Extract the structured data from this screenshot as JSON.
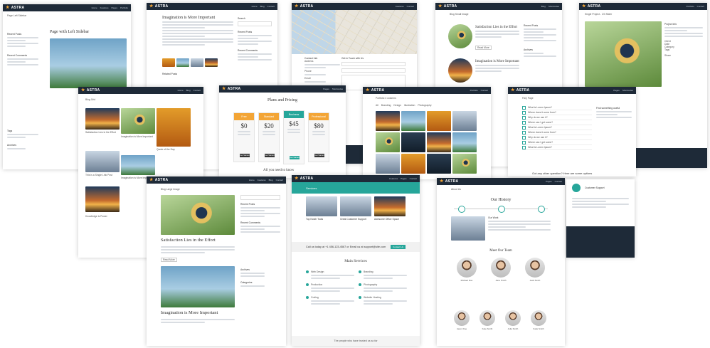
{
  "brand": {
    "name": "ASTRA",
    "accent": "#26a69a",
    "nav_bg": "#1e2a38",
    "logo_color": "#f3a536"
  },
  "menu": [
    "Home",
    "Features",
    "Pages",
    "Portfolio",
    "Blog",
    "Shortcodes",
    "Contact"
  ],
  "pages": {
    "left_sidebar": {
      "breadcrumb": "Page Left Sidebar",
      "title": "Page with Left Sidebar",
      "widgets": [
        "Recent Posts",
        "Recent Comments",
        "Archives",
        "Tags"
      ]
    },
    "imagination": {
      "title": "Imagination is More Important",
      "sidebar": [
        "Search",
        "Recent Posts",
        "Recent Comments"
      ],
      "related": "Related Posts"
    },
    "contact": {
      "info_title": "Contact Info",
      "form_title": "Get in Touch with Us",
      "address_label": "Address",
      "phone_label": "Phone",
      "email_label": "Email"
    },
    "blog_small": {
      "breadcrumb": "Blog Small Image",
      "post1": "Satisfaction Lies in the Effort",
      "post2": "Imagination is More Important",
      "read_more": "Read More",
      "widgets": [
        "Recent Posts",
        "Archives"
      ]
    },
    "single_project": {
      "breadcrumb": "Single Project - 2/3 Slider",
      "info": "Project Info",
      "share": "Share",
      "details": [
        "Client",
        "Date",
        "Category",
        "Tags"
      ]
    },
    "blog_grid": {
      "breadcrumb": "Blog Grid",
      "posts": [
        "Satisfaction Lies in the Effort",
        "Imagination is More Important",
        "Quote of the Day",
        "This is a Single Link Post",
        "Imagination is More Important",
        "Knowledge is Power"
      ]
    },
    "pricing": {
      "title": "Plans and Pricing",
      "plans": [
        {
          "name": "Free",
          "price": "$0",
          "color": "#f3a536"
        },
        {
          "name": "Standard",
          "price": "$20",
          "color": "#f3a536"
        },
        {
          "name": "Business",
          "price": "$45",
          "color": "#26a69a"
        },
        {
          "name": "Professional",
          "price": "$80",
          "color": "#f3a536"
        }
      ],
      "cta": "Get Started",
      "tagline": "All you need to know"
    },
    "portfolio": {
      "breadcrumb": "Portfolio 4 columns",
      "filters": [
        "All",
        "Branding",
        "Design",
        "Illustration",
        "Photography",
        "Web Design"
      ]
    },
    "faq": {
      "breadcrumb": "FAQ Page",
      "questions": [
        "What is Lorem Ipsum?",
        "Where does it come from?",
        "Why do we use it?",
        "Where can I get some?",
        "What is Lorem Ipsum?",
        "Where does it come from?",
        "Why do we use it?",
        "Where can I get some?",
        "What is Lorem Ipsum?"
      ],
      "side_title": "Find something useful",
      "footer_cta": "Got any other question? Here are some options"
    },
    "blog_large": {
      "breadcrumb": "Blog Large Image",
      "post1": "Satisfaction Lies in the Effort",
      "post2": "Imagination is More Important",
      "read_more": "Read More",
      "widgets": [
        "Recent Posts",
        "Recent Comments",
        "Archives",
        "Categories"
      ]
    },
    "services": {
      "breadcrumb": "Services",
      "boxes": [
        "Top Notch Tools",
        "Great Customer Support",
        "Awesome Office Space"
      ],
      "cta": "Call us today at +1 456-123-4567 or Email us at support@site.com",
      "cta_button": "Contact Us",
      "main_title": "Main Services",
      "list": [
        "Web Design",
        "Branding",
        "Production",
        "Photography",
        "Coding",
        "Website Hosting"
      ],
      "footer": "The people who have trusted us so far"
    },
    "about": {
      "breadcrumb": "About Us",
      "history_title": "Our History",
      "work_title": "Our Work",
      "team_title": "Meet Our Team",
      "team": [
        "Michael Doe",
        "Jane Smith",
        "Jack Smith",
        "Jason Doe",
        "Kate Smith",
        "Julia Smith",
        "Katie Smith"
      ],
      "side_title": "Customer Support"
    }
  }
}
